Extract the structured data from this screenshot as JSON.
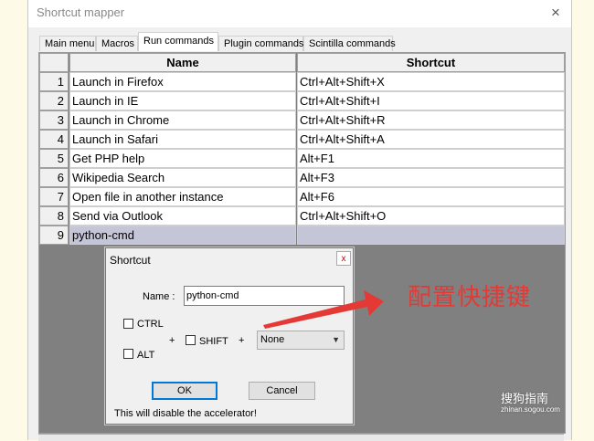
{
  "window": {
    "title": "Shortcut mapper",
    "close_glyph": "×"
  },
  "tabs": [
    {
      "label": "Main menu"
    },
    {
      "label": "Macros"
    },
    {
      "label": "Run commands",
      "active": true
    },
    {
      "label": "Plugin commands"
    },
    {
      "label": "Scintilla commands"
    }
  ],
  "grid": {
    "headers": {
      "name": "Name",
      "shortcut": "Shortcut"
    },
    "rows": [
      {
        "num": "1",
        "name": "Launch in Firefox",
        "shortcut": "Ctrl+Alt+Shift+X"
      },
      {
        "num": "2",
        "name": "Launch in IE",
        "shortcut": "Ctrl+Alt+Shift+I"
      },
      {
        "num": "3",
        "name": "Launch in Chrome",
        "shortcut": "Ctrl+Alt+Shift+R"
      },
      {
        "num": "4",
        "name": "Launch in Safari",
        "shortcut": "Ctrl+Alt+Shift+A"
      },
      {
        "num": "5",
        "name": "Get PHP help",
        "shortcut": "Alt+F1"
      },
      {
        "num": "6",
        "name": "Wikipedia Search",
        "shortcut": "Alt+F3"
      },
      {
        "num": "7",
        "name": "Open file in another instance",
        "shortcut": "Alt+F6"
      },
      {
        "num": "8",
        "name": "Send via Outlook",
        "shortcut": "Ctrl+Alt+Shift+O"
      },
      {
        "num": "9",
        "name": "python-cmd",
        "shortcut": "",
        "selected": true
      }
    ]
  },
  "dialog": {
    "title": "Shortcut",
    "close_glyph": "x",
    "name_label": "Name :",
    "name_value": "python-cmd",
    "ctrl_label": "CTRL",
    "alt_label": "ALT",
    "shift_label": "SHIFT",
    "plus": "+",
    "key_selected": "None",
    "ok_label": "OK",
    "cancel_label": "Cancel",
    "note": "This will disable the accelerator!"
  },
  "annotation": {
    "text": "配置快捷键",
    "color": "#e53935"
  },
  "watermark": {
    "text": "搜狗指南",
    "sub": "zhinan.sogou.com"
  }
}
